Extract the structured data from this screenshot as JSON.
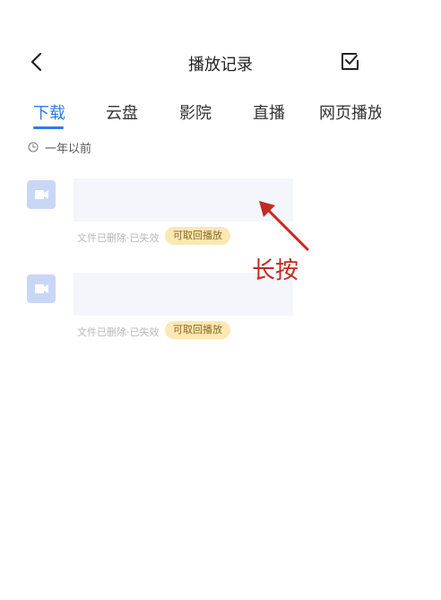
{
  "header": {
    "title": "播放记录"
  },
  "tabs": [
    {
      "label": "下载",
      "active": true
    },
    {
      "label": "云盘",
      "active": false
    },
    {
      "label": "影院",
      "active": false
    },
    {
      "label": "直播",
      "active": false
    },
    {
      "label": "网页播放",
      "active": false
    }
  ],
  "section": {
    "label": "一年以前"
  },
  "items": [
    {
      "status": "文件已删除·已失效",
      "badge": "可取回播放"
    },
    {
      "status": "文件已删除·已失效",
      "badge": "可取回播放"
    }
  ],
  "annotation": {
    "text": "长按"
  },
  "colors": {
    "accent": "#2f7ce8",
    "badge_bg": "#fbe8b3",
    "video_icon": "#c9d7f7",
    "annotation": "#c22b21"
  }
}
